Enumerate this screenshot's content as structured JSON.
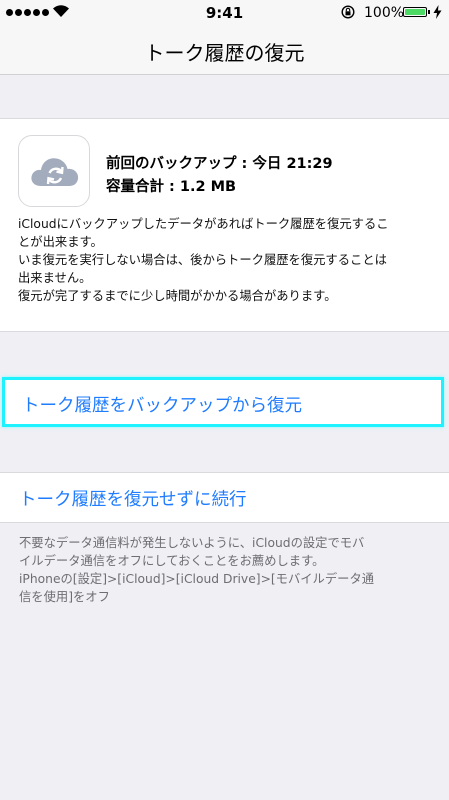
{
  "status_bar": {
    "time": "9:41",
    "battery_percent": "100%",
    "signal_bars": 5,
    "icons": [
      "signal-dots-icon",
      "wifi-icon",
      "rotation-lock-icon",
      "battery-icon",
      "charging-bolt-icon"
    ],
    "battery_fill_color": "#4cd964"
  },
  "nav": {
    "title": "トーク履歴の復元"
  },
  "backup_info": {
    "icon": "icloud-sync-icon",
    "last_backup": "前回のバックアップ : 今日 21:29",
    "total_size": "容量合計 : 1.2 MB",
    "description": "iCloudにバックアップしたデータがあればトーク履歴を復元するこ\nとが出来ます。\nいま復元を実行しない場合は、後からトーク履歴を復元することは\n出来ません。\n復元が完了するまでに少し時間がかかる場合があります。"
  },
  "actions": {
    "restore_label": "トーク履歴をバックアップから復元",
    "skip_label": "トーク履歴を復元せずに続行",
    "link_color": "#1f7cff",
    "highlight_color": "#1ff2ff"
  },
  "footer": {
    "note": "不要なデータ通信料が発生しないように、iCloudの設定でモバ\nイルデータ通信をオフにしておくことをお薦めします。\niPhoneの[設定]>[iCloud]>[iCloud Drive]>[モバイルデータ通\n信を使用]をオフ"
  }
}
